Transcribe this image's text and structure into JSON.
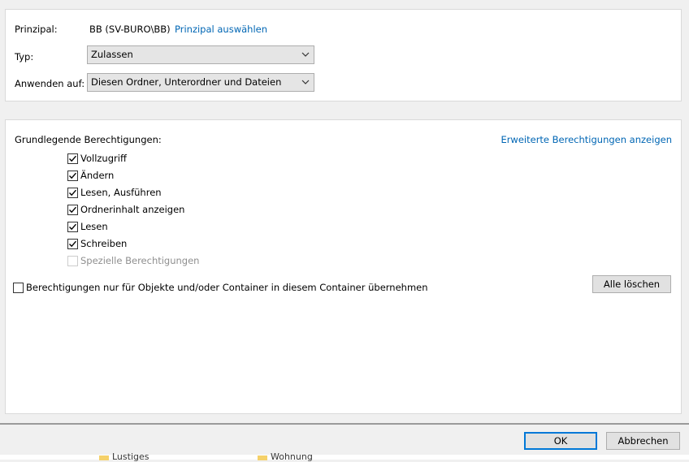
{
  "principal": {
    "label": "Prinzipal:",
    "value": "BB (SV-BURO\\BB)",
    "select_link": "Prinzipal auswählen"
  },
  "type": {
    "label": "Typ:",
    "selected": "Zulassen"
  },
  "apply_to": {
    "label": "Anwenden auf:",
    "selected": "Diesen Ordner, Unterordner und Dateien"
  },
  "permissions": {
    "heading": "Grundlegende Berechtigungen:",
    "advanced_link": "Erweiterte Berechtigungen anzeigen",
    "items": [
      {
        "label": "Vollzugriff",
        "checked": true,
        "enabled": true
      },
      {
        "label": "Ändern",
        "checked": true,
        "enabled": true
      },
      {
        "label": "Lesen, Ausführen",
        "checked": true,
        "enabled": true
      },
      {
        "label": "Ordnerinhalt anzeigen",
        "checked": true,
        "enabled": true
      },
      {
        "label": "Lesen",
        "checked": true,
        "enabled": true
      },
      {
        "label": "Schreiben",
        "checked": true,
        "enabled": true
      },
      {
        "label": "Spezielle Berechtigungen",
        "checked": false,
        "enabled": false
      }
    ],
    "inherit_option": {
      "label": "Berechtigungen nur für Objekte und/oder Container in diesem Container übernehmen",
      "checked": false
    },
    "clear_all_label": "Alle löschen"
  },
  "footer": {
    "ok_label": "OK",
    "cancel_label": "Abbrechen"
  },
  "background": {
    "items": [
      "Lustiges",
      "Wohnung"
    ]
  }
}
